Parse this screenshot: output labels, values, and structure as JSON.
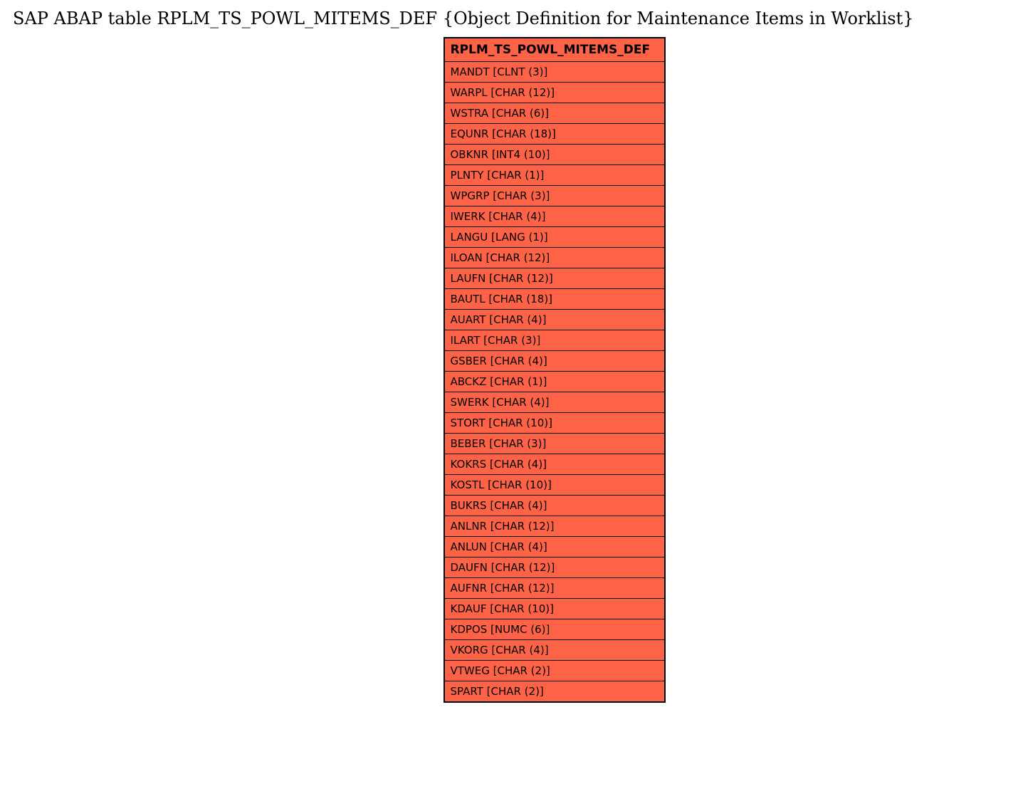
{
  "title": "SAP ABAP table RPLM_TS_POWL_MITEMS_DEF {Object Definition for Maintenance Items in Worklist}",
  "table": {
    "header": "RPLM_TS_POWL_MITEMS_DEF",
    "rows": [
      "MANDT [CLNT (3)]",
      "WARPL [CHAR (12)]",
      "WSTRA [CHAR (6)]",
      "EQUNR [CHAR (18)]",
      "OBKNR [INT4 (10)]",
      "PLNTY [CHAR (1)]",
      "WPGRP [CHAR (3)]",
      "IWERK [CHAR (4)]",
      "LANGU [LANG (1)]",
      "ILOAN [CHAR (12)]",
      "LAUFN [CHAR (12)]",
      "BAUTL [CHAR (18)]",
      "AUART [CHAR (4)]",
      "ILART [CHAR (3)]",
      "GSBER [CHAR (4)]",
      "ABCKZ [CHAR (1)]",
      "SWERK [CHAR (4)]",
      "STORT [CHAR (10)]",
      "BEBER [CHAR (3)]",
      "KOKRS [CHAR (4)]",
      "KOSTL [CHAR (10)]",
      "BUKRS [CHAR (4)]",
      "ANLNR [CHAR (12)]",
      "ANLUN [CHAR (4)]",
      "DAUFN [CHAR (12)]",
      "AUFNR [CHAR (12)]",
      "KDAUF [CHAR (10)]",
      "KDPOS [NUMC (6)]",
      "VKORG [CHAR (4)]",
      "VTWEG [CHAR (2)]",
      "SPART [CHAR (2)]"
    ]
  }
}
